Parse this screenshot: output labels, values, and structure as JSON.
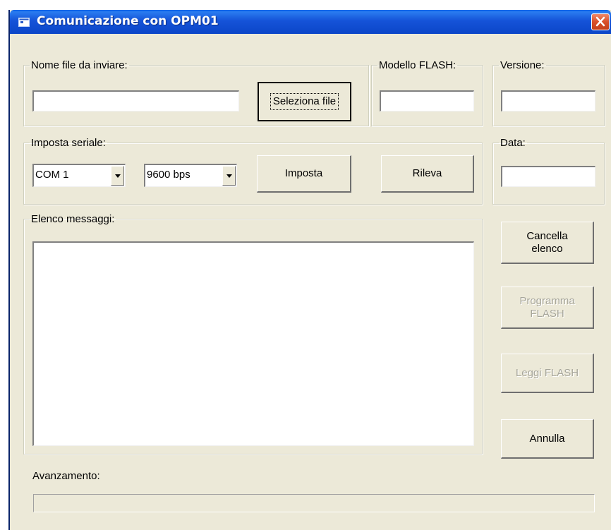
{
  "window": {
    "title": "Comunicazione con OPM01"
  },
  "file_group": {
    "legend": "Nome file da inviare:",
    "filename_value": "",
    "select_button": "Seleziona file"
  },
  "flash_model_group": {
    "legend": "Modello FLASH:",
    "value": ""
  },
  "version_group": {
    "legend": "Versione:",
    "value": ""
  },
  "serial_group": {
    "legend": "Imposta seriale:",
    "port_value": "COM 1",
    "baud_value": "9600 bps",
    "set_button": "Imposta",
    "detect_button": "Rileva"
  },
  "date_group": {
    "legend": "Data:",
    "value": ""
  },
  "messages_group": {
    "legend": "Elenco messaggi:",
    "items": []
  },
  "side_buttons": {
    "clear_list": "Cancella elenco",
    "program_flash": "Programma FLASH",
    "read_flash": "Leggi FLASH",
    "cancel": "Annulla"
  },
  "progress": {
    "label": "Avanzamento:",
    "value": 0
  }
}
